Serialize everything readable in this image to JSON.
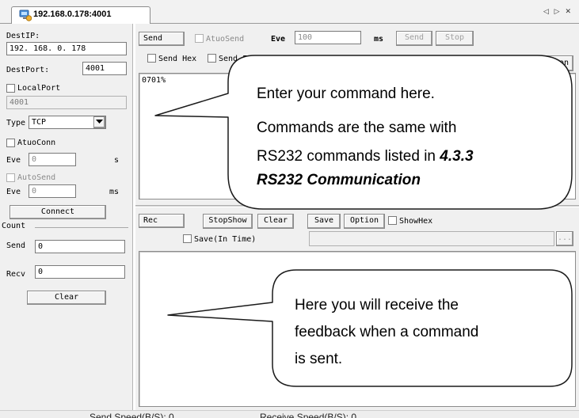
{
  "tab": {
    "title": "192.168.0.178:4001",
    "nav_arrows": "◁ ▷ ✕"
  },
  "left": {
    "dest_ip_label": "DestIP:",
    "dest_ip_value": "192. 168. 0. 178",
    "dest_port_label": "DestPort:",
    "dest_port_value": "4001",
    "local_port_label": "LocalPort",
    "local_port_value": "4001",
    "type_label": "Type",
    "type_value": "TCP",
    "auto_conn_label": "AtuoConn",
    "eve_label": "Eve",
    "auto_conn_eve_value": "0",
    "seconds_unit": "s",
    "auto_send_label": "AutoSend",
    "auto_send_eve_value": "0",
    "ms_unit": "ms",
    "connect_button": "Connect",
    "count_label": "Count",
    "send_label": "Send",
    "send_count": "0",
    "recv_label": "Recv",
    "recv_count": "0",
    "clear_button": "Clear"
  },
  "send_panel": {
    "send_button": "Send",
    "auto_send_label": "AtuoSend",
    "eve_label": "Eve",
    "eve_value": "100",
    "ms_unit": "ms",
    "send_disabled_button": "Send",
    "stop_button": "Stop",
    "send_hex_label": "Send Hex",
    "send_partial_label": "Send F",
    "option_button_partial": "ion",
    "text_content": "0701%"
  },
  "rec_panel": {
    "rec_button": "Rec",
    "stop_show_button": "StopShow",
    "clear_button": "Clear",
    "save_button": "Save",
    "option_button": "Option",
    "show_hex_label": "ShowHex",
    "save_in_time_label": "Save(In Time)",
    "browse_button": "..."
  },
  "status": {
    "send_speed": "Send Speed(B/S): 0",
    "receive_speed": "Receive Speed(B/S): 0"
  },
  "callouts": {
    "top_line1": "Enter your command here.",
    "top_line2a": "Commands are the same with",
    "top_line2b": "RS232 commands listed in ",
    "top_line2c": "4.3.3",
    "top_line2d": "RS232 Communication",
    "bottom_line1": "Here you will receive the",
    "bottom_line2": "feedback when a command",
    "bottom_line3": "is sent."
  }
}
